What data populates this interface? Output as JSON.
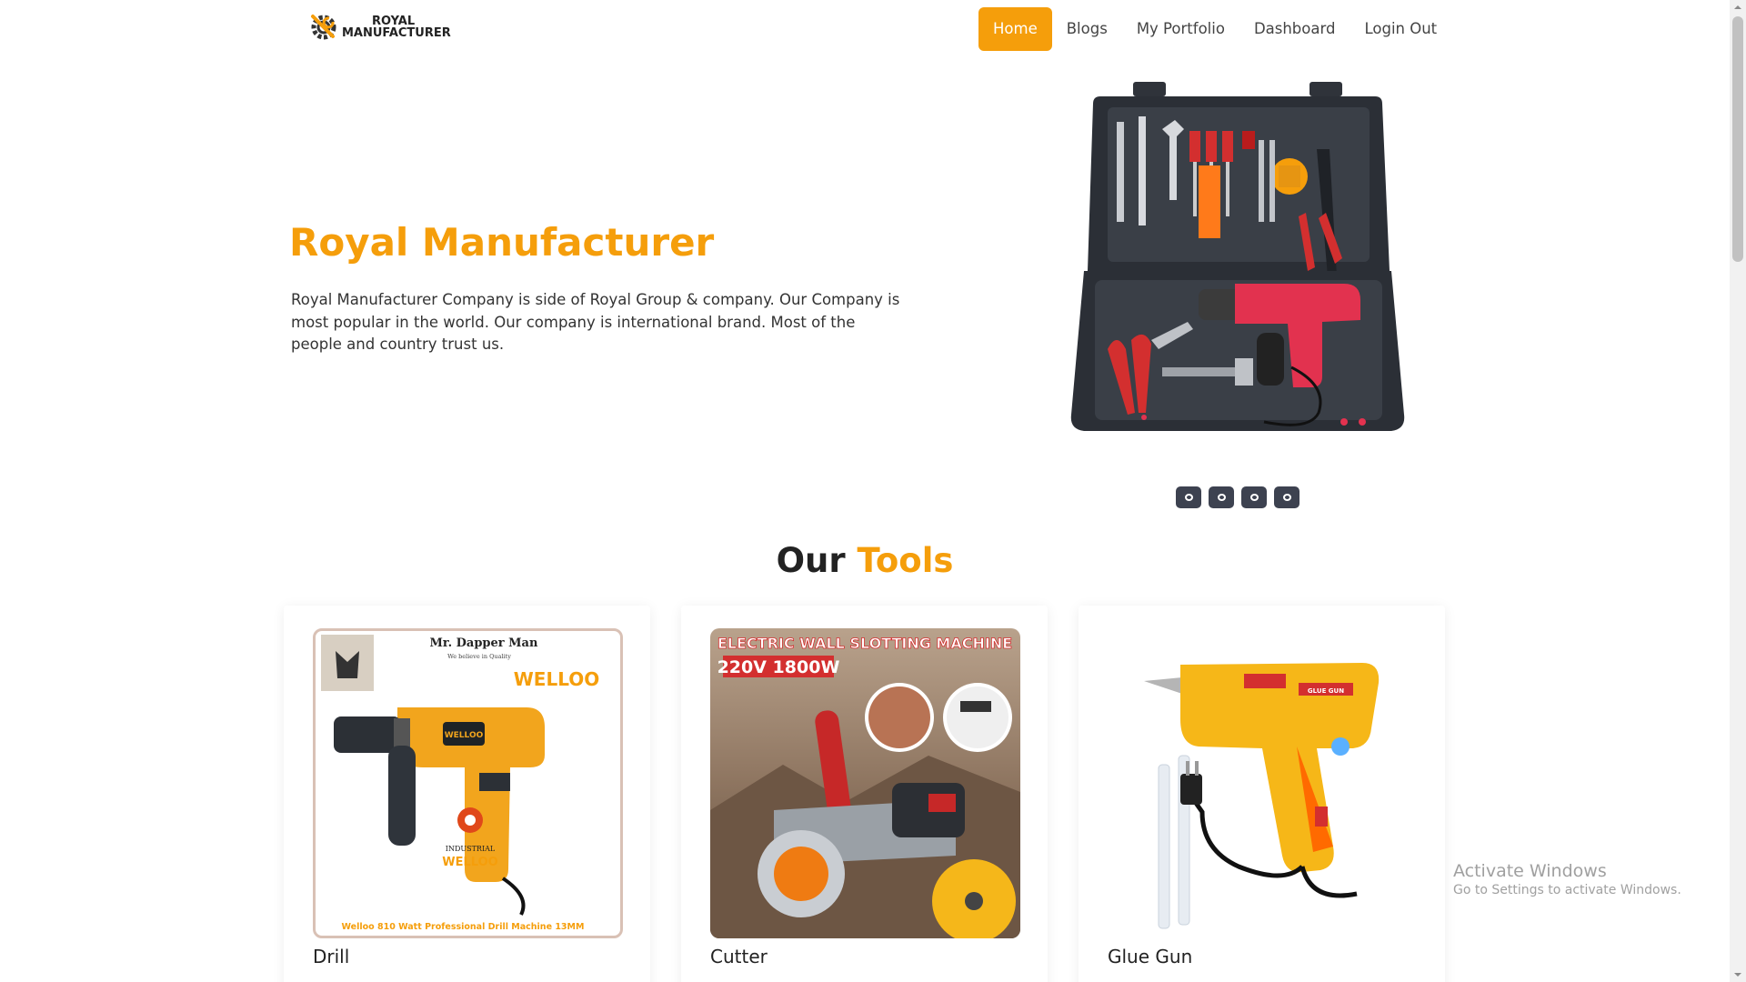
{
  "brand": {
    "line1": "ROYAL",
    "line2": "MANUFACTURER",
    "accent": "#f59e0b",
    "icon": "gear-wrench-logo-icon"
  },
  "nav": {
    "items": [
      {
        "label": "Home",
        "active": true
      },
      {
        "label": "Blogs",
        "active": false
      },
      {
        "label": "My Portfolio",
        "active": false
      },
      {
        "label": "Dashboard",
        "active": false
      },
      {
        "label": "Login Out",
        "active": false
      }
    ]
  },
  "hero": {
    "title": "Royal Manufacturer",
    "description": "Royal Manufacturer Company is side of Royal Group & company. Our Company is most popular in the world. Our company is international brand. Most of the people and country trust us.",
    "image": "tool-kit-case-image",
    "slider_dots": 4
  },
  "tools": {
    "title_part1": "Our ",
    "title_part2": "Tools",
    "items": [
      {
        "name": "Drill",
        "image": "drill-image",
        "image_text": {
          "brand_badge": "Mr. Dapper Man",
          "tagline": "We believe in Quality",
          "brand": "WELLOO",
          "logo_text": "INDUSTRIAL",
          "logo_brand": "WELLOO",
          "caption": "Welloo 810 Watt Professional Drill Machine 13MM"
        }
      },
      {
        "name": "Cutter",
        "image": "cutter-image",
        "image_text": {
          "headline": "ELECTRIC WALL SLOTTING MACHINE",
          "spec": "220V 1800W"
        }
      },
      {
        "name": "Glue Gun",
        "image": "glue-gun-image",
        "image_text": {
          "label": "GLUE GUN"
        }
      }
    ]
  },
  "watermark": {
    "title": "Activate Windows",
    "subtitle": "Go to Settings to activate Windows."
  }
}
